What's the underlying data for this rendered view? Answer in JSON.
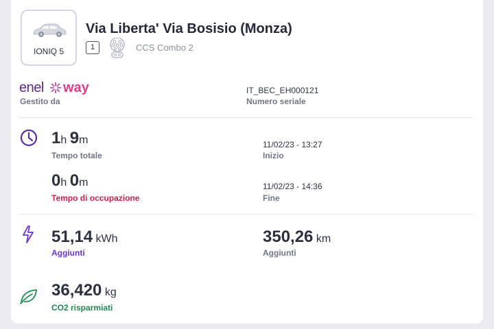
{
  "vehicle": {
    "name": "IONIQ 5"
  },
  "station": {
    "title": "Via Liberta' Via Bosisio (Monza)",
    "connector_number": "1",
    "connector_type": "CCS Combo 2"
  },
  "operator": {
    "logo_text_left": "enel",
    "logo_text_right": "way",
    "managed_label": "Gestito da",
    "serial_value": "IT_BEC_EH000121",
    "serial_label": "Numero seriale"
  },
  "time": {
    "total_hours": "1",
    "total_hours_unit": "h",
    "total_minutes": "9",
    "total_minutes_unit": "m",
    "total_label": "Tempo totale",
    "start_value": "11/02/23 - 13:27",
    "start_label": "Inizio",
    "occupancy_hours": "0",
    "occupancy_hours_unit": "h",
    "occupancy_minutes": "0",
    "occupancy_minutes_unit": "m",
    "occupancy_label": "Tempo di occupazione",
    "end_value": "11/02/23 - 14:36",
    "end_label": "Fine"
  },
  "energy": {
    "value": "51,14",
    "unit": "kWh",
    "label": "Aggiunti",
    "range_value": "350,26",
    "range_unit": "km",
    "range_label": "Aggiunti"
  },
  "co2": {
    "value": "36,420",
    "unit": "kg",
    "label": "CO2 risparmiati"
  },
  "colors": {
    "purple": "#6a34d8",
    "red": "#d81b4a",
    "green": "#1f8a50",
    "enel_purple": "#5b2a8e",
    "enel_pink": "#e63c8c"
  },
  "icons": {
    "car": "car-icon",
    "plug": "ccs-plug-icon",
    "clock": "clock-icon",
    "energy": "lightning-icon",
    "co2": "leaf-icon"
  }
}
